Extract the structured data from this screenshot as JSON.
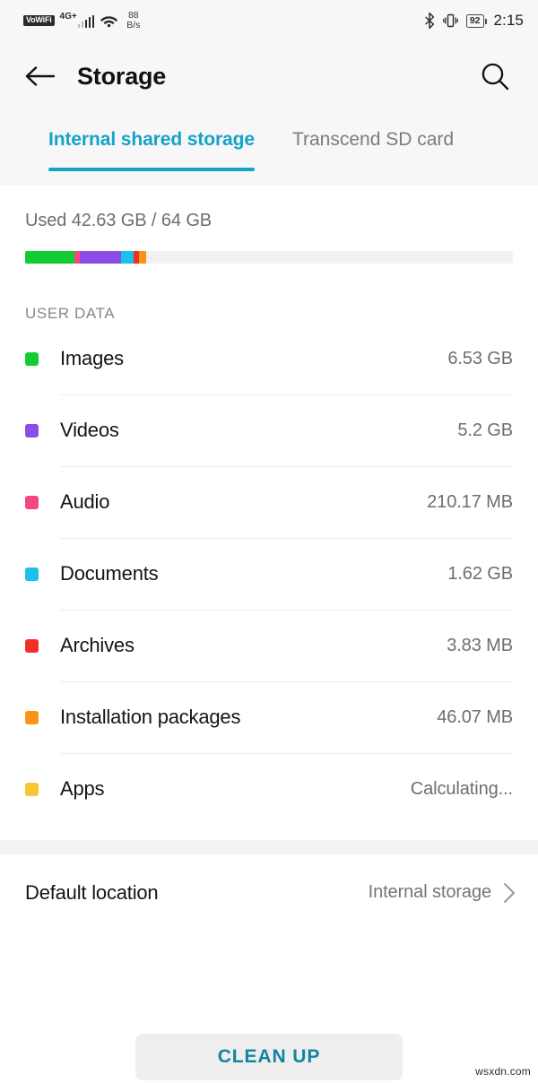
{
  "status_bar": {
    "vowifi_label": "VoWiFi",
    "network_label": "4G",
    "network_superscript": "+",
    "data_speed_value": "88",
    "data_speed_unit": "B/s",
    "battery_percent": "92",
    "time": "2:15",
    "icons": [
      "vowifi-badge",
      "signal-bars-icon",
      "wifi-icon",
      "bluetooth-icon",
      "vibrate-icon",
      "battery-icon"
    ]
  },
  "app_bar": {
    "title": "Storage",
    "back_icon": "back-arrow-icon",
    "search_icon": "search-icon"
  },
  "tabs": {
    "active_index": 0,
    "items": [
      {
        "label": "Internal shared storage"
      },
      {
        "label": "Transcend SD card"
      }
    ]
  },
  "usage": {
    "summary": "Used 42.63 GB / 64 GB",
    "used_value": "42.63 GB",
    "total_value": "64 GB",
    "segments": [
      {
        "name": "Images",
        "color": "#12cc33",
        "percent": 10.2
      },
      {
        "name": "Audio",
        "color": "#f5477f",
        "percent": 1.1
      },
      {
        "name": "Videos",
        "color": "#8b4ce8",
        "percent": 8.4
      },
      {
        "name": "Documents",
        "color": "#1ec0e8",
        "percent": 2.6
      },
      {
        "name": "Archives",
        "color": "#ee3124",
        "percent": 1.0
      },
      {
        "name": "Installation packages",
        "color": "#fb9415",
        "percent": 1.5
      }
    ],
    "track_color": "#f1f1f1"
  },
  "section": {
    "user_data_label": "USER DATA"
  },
  "storage_items": [
    {
      "label": "Images",
      "value": "6.53 GB",
      "color": "#12cc33"
    },
    {
      "label": "Videos",
      "value": "5.2 GB",
      "color": "#8b4ce8"
    },
    {
      "label": "Audio",
      "value": "210.17 MB",
      "color": "#f5477f"
    },
    {
      "label": "Documents",
      "value": "1.62 GB",
      "color": "#1ec0e8"
    },
    {
      "label": "Archives",
      "value": "3.83 MB",
      "color": "#ee3124"
    },
    {
      "label": "Installation packages",
      "value": "46.07 MB",
      "color": "#fb9415"
    },
    {
      "label": "Apps",
      "value": "Calculating...",
      "color": "#f9c736"
    }
  ],
  "default_location": {
    "title": "Default location",
    "value": "Internal storage",
    "chevron_icon": "chevron-right-icon"
  },
  "cleanup": {
    "label": "CLEAN UP"
  },
  "watermark": {
    "text": "wsxdn.com"
  },
  "theme": {
    "accent": "#14a3c7",
    "cleanup_text": "#14849e",
    "appbar_bg": "#f7f7f7",
    "content_bg": "#ffffff"
  }
}
